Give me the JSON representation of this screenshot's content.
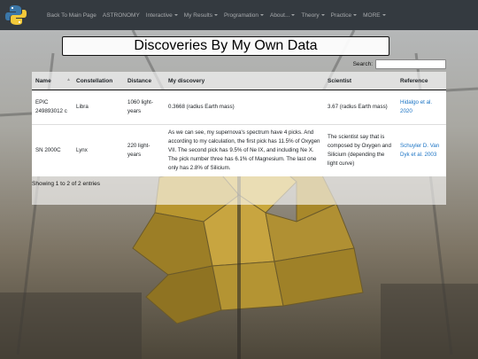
{
  "nav": {
    "items": [
      {
        "label": "Back To Main Page",
        "dropdown": false
      },
      {
        "label": "ASTRONOMY",
        "dropdown": false
      },
      {
        "label": "Interactive",
        "dropdown": true
      },
      {
        "label": "My Results",
        "dropdown": true
      },
      {
        "label": "Programation",
        "dropdown": true
      },
      {
        "label": "About...",
        "dropdown": true
      },
      {
        "label": "Theory",
        "dropdown": true
      },
      {
        "label": "Practice",
        "dropdown": true
      },
      {
        "label": "MORE",
        "dropdown": true
      }
    ]
  },
  "page": {
    "title": "Discoveries By My Own Data",
    "search_label": "Search:",
    "search_value": "",
    "info_text": "Showing 1 to 2 of 2 entries"
  },
  "table": {
    "columns": [
      "Name",
      "Constellation",
      "Distance",
      "My discovery",
      "Scientist",
      "Reference"
    ],
    "rows": [
      {
        "name": "EPIC 249893012 c",
        "constellation": "Libra",
        "distance": "1060 light-years",
        "discovery": "0.3668 (radius Earth mass)",
        "scientist": "3.67 (radius Earth mass)",
        "reference": "Hidalgo et al. 2020"
      },
      {
        "name": "SN 2000C",
        "constellation": "Lynx",
        "distance": "220 light-years",
        "discovery": "As we can see, my supernova's spectrum have 4 picks. And according to my calculation, the first pick has 11.5% of Oxygen VII. The second pick has 9.5% of Ne IX, and including Ne X. The pick number three has 6.1% of Magnesium. The last one only has 2.8% of Silicium.",
        "scientist": "The scientist say that is composed by Oxygen and Silicium (depending the light curve)",
        "reference": "Schuyler D. Van Dyk et al. 2003"
      }
    ]
  },
  "colors": {
    "navbar": "#343a40",
    "link": "#1a73c4"
  }
}
